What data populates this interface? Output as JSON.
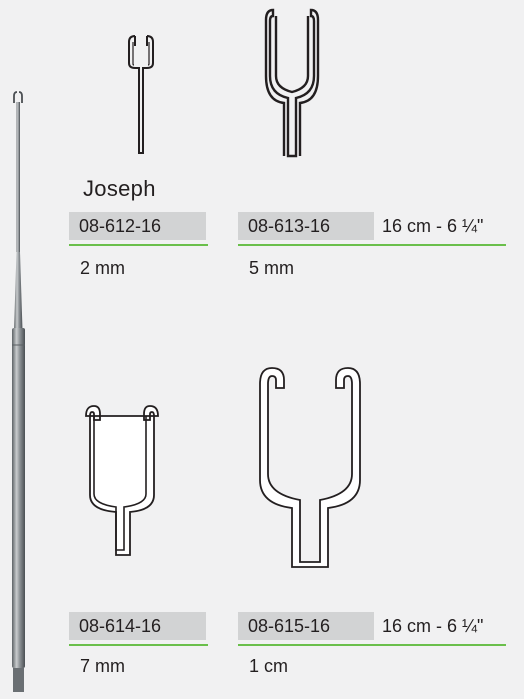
{
  "product_name": "Joseph",
  "items": [
    {
      "code": "08-612-16",
      "size": "2 mm"
    },
    {
      "code": "08-613-16",
      "size": "5 mm",
      "length": "16 cm - 6 ¼\""
    },
    {
      "code": "08-614-16",
      "size": "7 mm"
    },
    {
      "code": "08-615-16",
      "size": "1 cm",
      "length": "16 cm - 6 ¼\""
    }
  ],
  "colors": {
    "background": "#f1f1f2",
    "code_box": "#d2d3d4",
    "accent_line": "#6abf4b",
    "text": "#231f20"
  }
}
